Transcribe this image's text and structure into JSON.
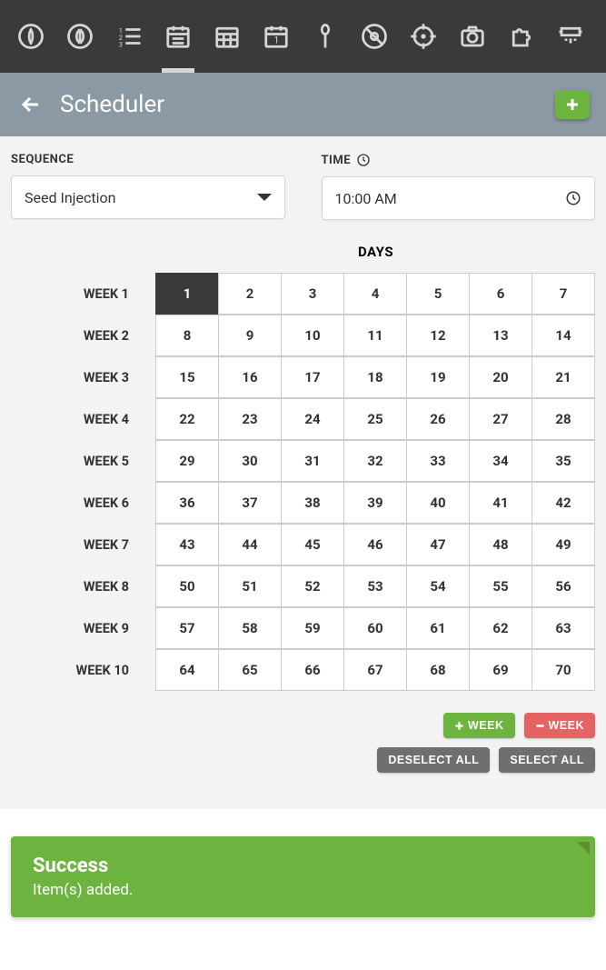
{
  "header": {
    "title": "Scheduler"
  },
  "form": {
    "sequence": {
      "label": "SEQUENCE",
      "value": "Seed Injection"
    },
    "time": {
      "label": "TIME",
      "value": "10:00 AM"
    }
  },
  "days": {
    "title": "DAYS",
    "weekLabelPrefix": "WEEK ",
    "weeks": [
      1,
      2,
      3,
      4,
      5,
      6,
      7,
      8,
      9,
      10
    ],
    "columns": 7,
    "selected": [
      1
    ]
  },
  "buttons": {
    "addWeek": "WEEK",
    "removeWeek": "WEEK",
    "deselectAll": "DESELECT ALL",
    "selectAll": "SELECT ALL"
  },
  "toast": {
    "title": "Success",
    "message": "Item(s) added."
  }
}
